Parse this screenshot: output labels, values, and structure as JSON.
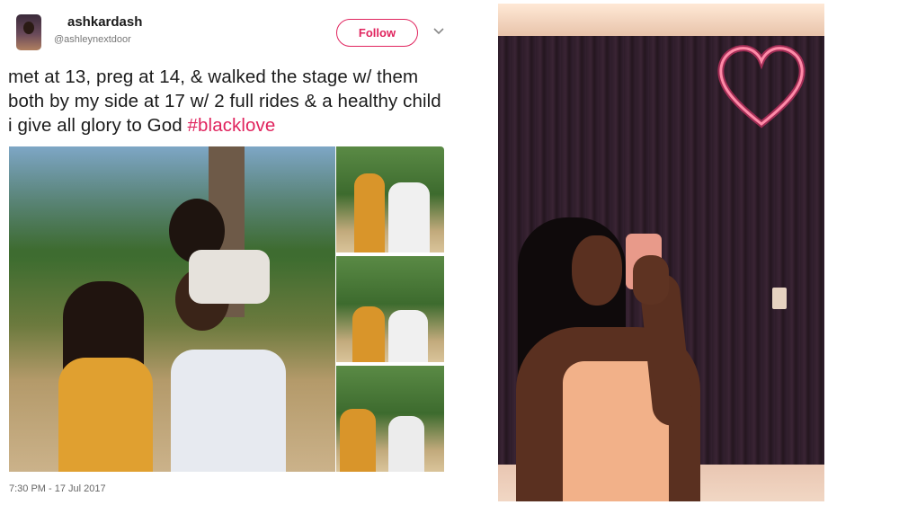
{
  "tweet": {
    "display_name": "ashkardash",
    "handle": "@ashleynextdoor",
    "follow_label": "Follow",
    "caret_icon": "chevron-down-icon",
    "text": "met at 13, preg at 14, & walked the stage w/ them both by my side at 17 w/ 2 full rides & a healthy child i give all glory to God ",
    "hashtag": "#blacklove",
    "timestamp": "7:30 PM - 17 Jul 2017",
    "accent_color": "#e0245e"
  }
}
